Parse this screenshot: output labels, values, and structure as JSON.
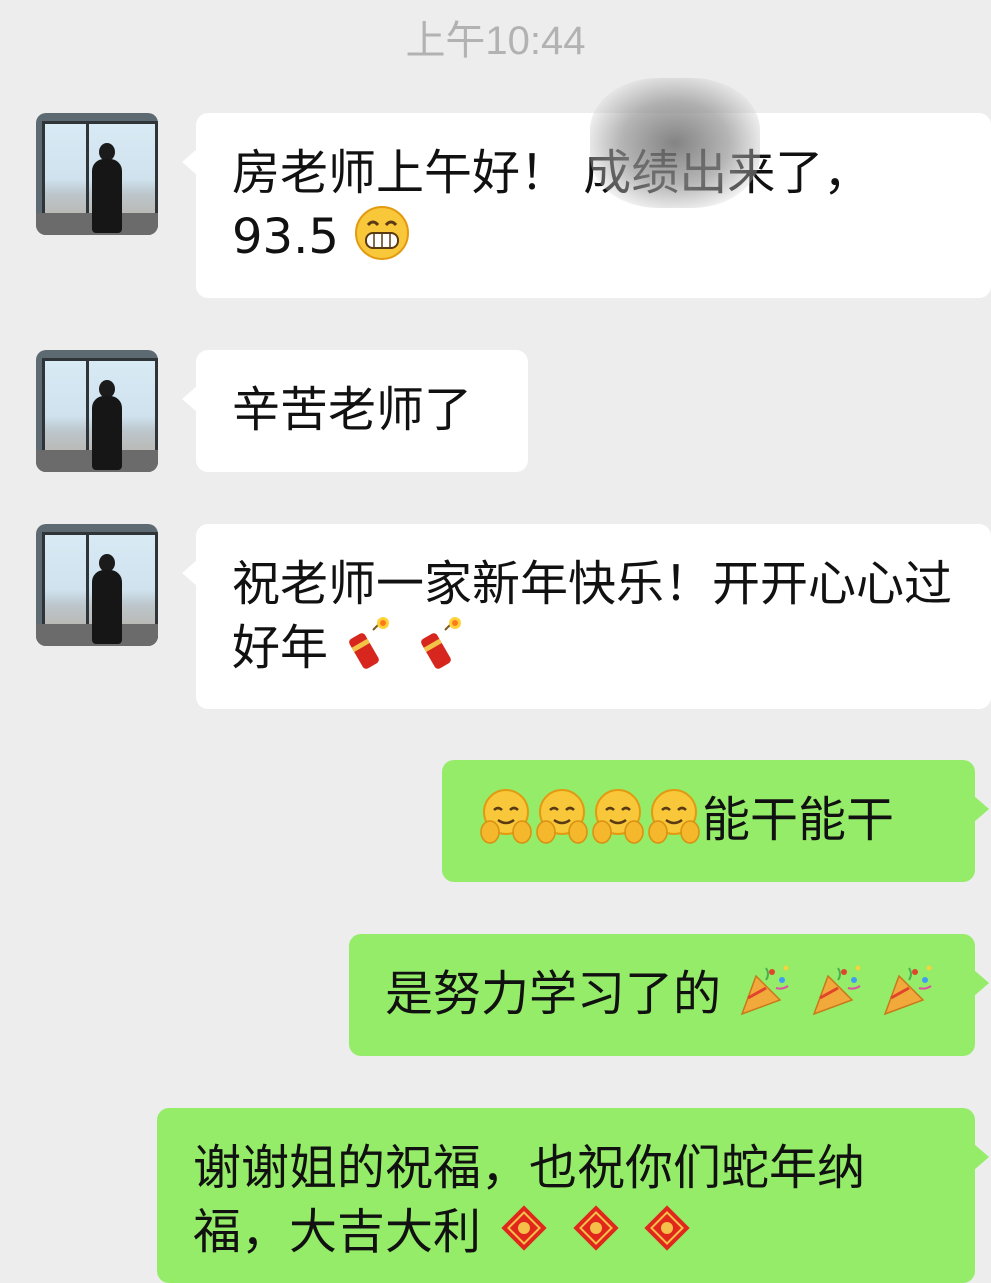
{
  "timestamp": "上午10:44",
  "messages": [
    {
      "side": "left",
      "text": "房老师上午好！ 成绩出来了，93.5",
      "emoji": "grinning-face-emoji"
    },
    {
      "side": "left",
      "text": "辛苦老师了"
    },
    {
      "side": "left",
      "text": "祝老师一家新年快乐！开开心心过好年",
      "emoji": "firecracker-emoji x2"
    },
    {
      "side": "right",
      "text": "能干能干",
      "emoji": "hugging-face-emoji x4"
    },
    {
      "side": "right",
      "text": "是努力学习了的",
      "emoji": "party-popper-emoji x3"
    },
    {
      "side": "right",
      "text": "谢谢姐的祝福，也祝你们蛇年纳福，大吉大利",
      "emoji": "congratulations-emoji, fu-emoji x3"
    }
  ],
  "colors": {
    "background": "#ededed",
    "incoming_bubble": "#ffffff",
    "outgoing_bubble": "#95ec69",
    "timestamp": "#b2b2b2"
  }
}
